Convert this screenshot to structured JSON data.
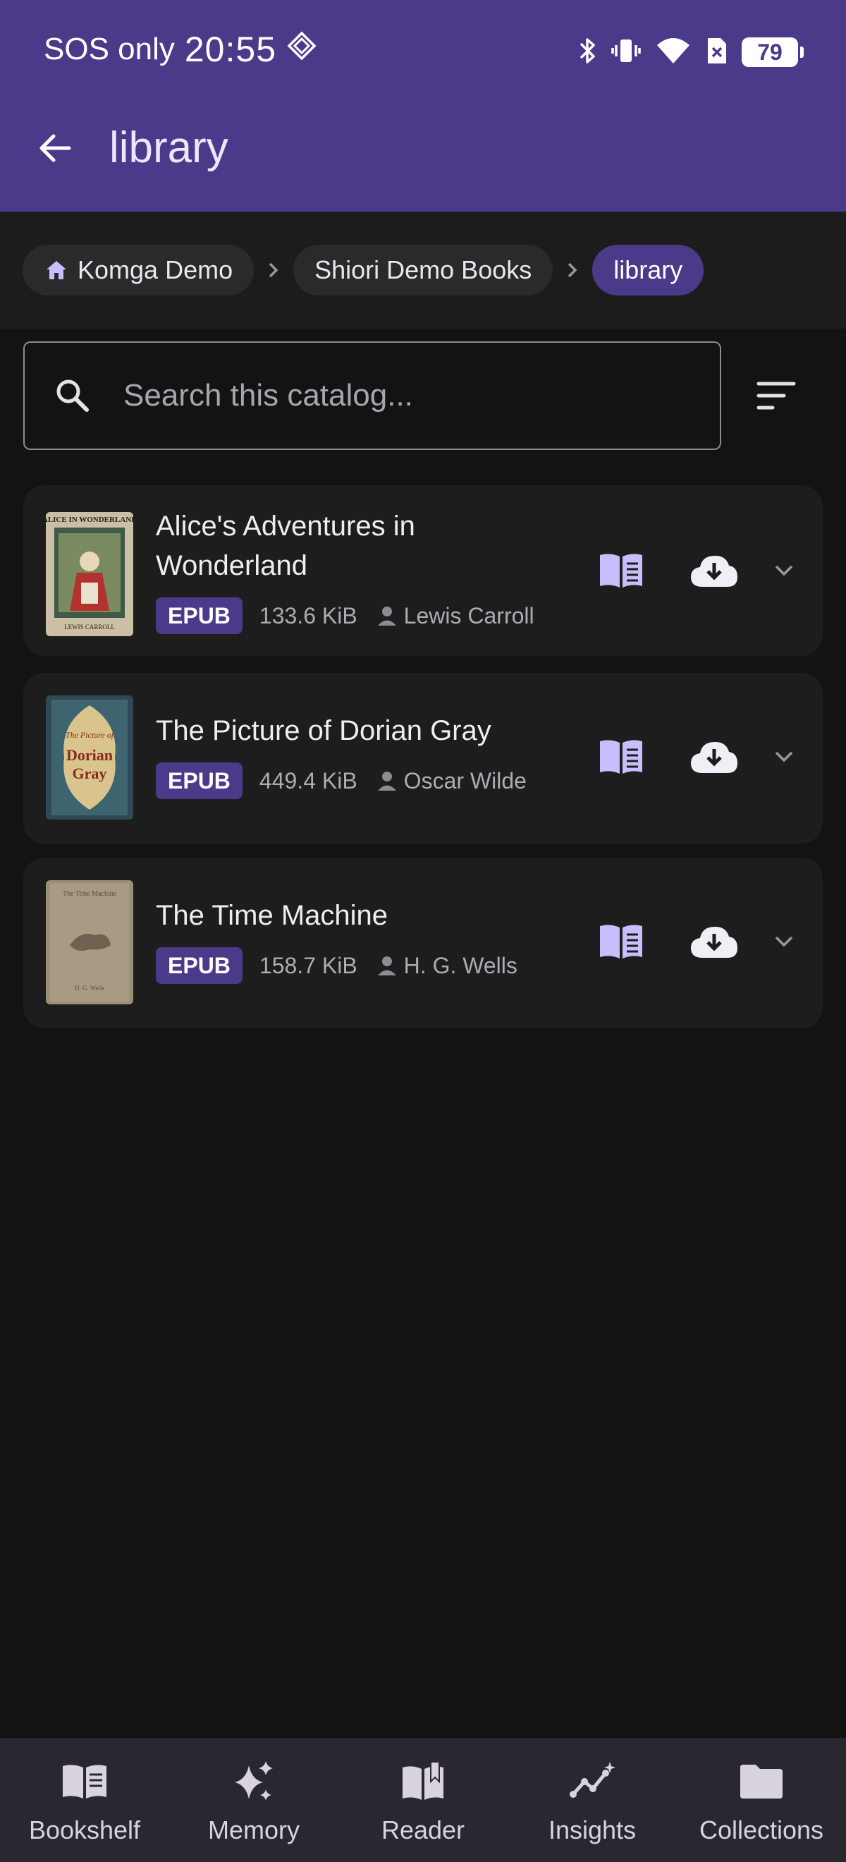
{
  "status_bar": {
    "carrier": "SOS only",
    "time": "20:55",
    "battery": "79"
  },
  "app_bar": {
    "title": "library",
    "back_icon": "arrow-back-icon"
  },
  "breadcrumbs": [
    {
      "label": "Komga Demo",
      "icon": "home-icon"
    },
    {
      "label": "Shiori Demo Books"
    },
    {
      "label": "library",
      "active": true
    }
  ],
  "search": {
    "placeholder": "Search this catalog...",
    "value": ""
  },
  "books": [
    {
      "title": "Alice's Adventures in Wonderland",
      "format": "EPUB",
      "size": "133.6 KiB",
      "author": "Lewis Carroll",
      "cover_text_top": "ALICE IN WONDERLAND",
      "cover_text_bottom": "LEWIS CARROLL"
    },
    {
      "title": "The Picture of Dorian Gray",
      "format": "EPUB",
      "size": "449.4 KiB",
      "author": "Oscar Wilde",
      "cover_text_top": "The Picture of",
      "cover_text_bottom": "Dorian Gray"
    },
    {
      "title": "The Time Machine",
      "format": "EPUB",
      "size": "158.7 KiB",
      "author": "H. G. Wells",
      "cover_text_top": "The Time Machine",
      "cover_text_bottom": "H. G. Wells"
    }
  ],
  "bottom_nav": [
    {
      "label": "Bookshelf",
      "icon": "bookshelf-icon"
    },
    {
      "label": "Memory",
      "icon": "sparkles-icon"
    },
    {
      "label": "Reader",
      "icon": "open-book-icon"
    },
    {
      "label": "Insights",
      "icon": "insights-icon"
    },
    {
      "label": "Collections",
      "icon": "folder-icon"
    }
  ],
  "colors": {
    "primary": "#4b398a",
    "accent_light": "#c9bdfb",
    "background": "#131313",
    "card": "#1d1d1d"
  }
}
